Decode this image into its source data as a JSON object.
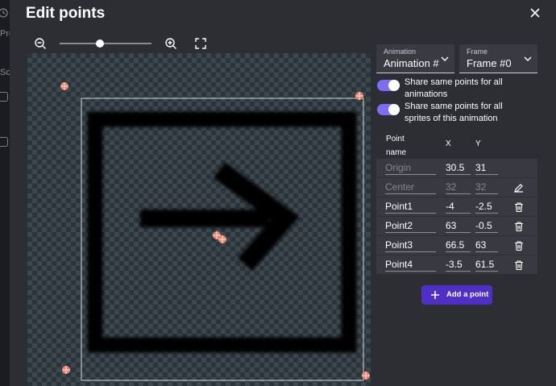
{
  "background_fragments": [
    "Pro",
    "Sc"
  ],
  "dialog": {
    "title": "Edit points"
  },
  "zoom": {
    "level": 0.43
  },
  "animation_select": {
    "label": "Animation",
    "value": "Animation #"
  },
  "frame_select": {
    "label": "Frame",
    "value": "Frame #0"
  },
  "toggles": [
    {
      "label": "Share same points for all animations",
      "on": true
    },
    {
      "label": "Share same points for all sprites of this animation",
      "on": true
    }
  ],
  "table": {
    "headers": {
      "name": "Point name",
      "x": "X",
      "y": "Y"
    },
    "rows": [
      {
        "name": "Origin",
        "x": "30.5",
        "y": "31",
        "action": "none"
      },
      {
        "name": "Center",
        "x": "32",
        "y": "32",
        "action": "edit-icon"
      },
      {
        "name": "Point1",
        "x": "-4",
        "y": "-2.5",
        "action": "trash-icon"
      },
      {
        "name": "Point2",
        "x": "63",
        "y": "-0.5",
        "action": "trash-icon"
      },
      {
        "name": "Point3",
        "x": "66.5",
        "y": "63",
        "action": "trash-icon"
      },
      {
        "name": "Point4",
        "x": "-3.5",
        "y": "61.5",
        "action": "trash-icon"
      }
    ]
  },
  "add_button": {
    "label": "Add a point",
    "icon": "plus-icon"
  },
  "colors": {
    "accent": "#7b6ef2",
    "primary_button": "#4f2fc6",
    "point_marker": "#e8836c"
  }
}
